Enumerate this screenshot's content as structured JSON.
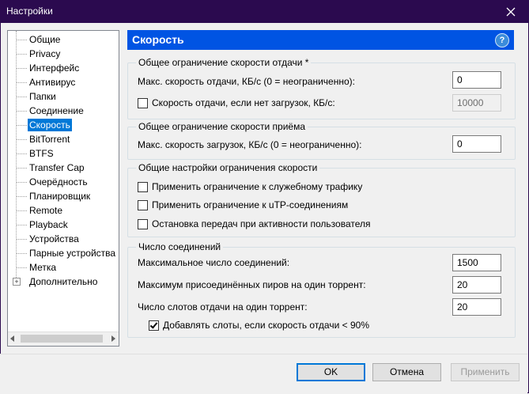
{
  "window": {
    "title": "Настройки"
  },
  "sidebar": {
    "items": [
      {
        "label": "Общие"
      },
      {
        "label": "Privacy"
      },
      {
        "label": "Интерфейс"
      },
      {
        "label": "Антивирус"
      },
      {
        "label": "Папки"
      },
      {
        "label": "Соединение"
      },
      {
        "label": "Скорость",
        "selected": true
      },
      {
        "label": "BitTorrent"
      },
      {
        "label": "BTFS"
      },
      {
        "label": "Transfer Cap"
      },
      {
        "label": "Очерёдность"
      },
      {
        "label": "Планировщик"
      },
      {
        "label": "Remote"
      },
      {
        "label": "Playback"
      },
      {
        "label": "Устройства"
      },
      {
        "label": "Парные устройства"
      },
      {
        "label": "Метка"
      },
      {
        "label": "Дополнительно",
        "expandable": true,
        "expander": "+"
      }
    ]
  },
  "panel": {
    "title": "Скорость",
    "help_label": "?",
    "upload_group": {
      "title": "Общее ограничение скорости отдачи *",
      "max_upload_label": "Макс. скорость отдачи, КБ/с (0 = неограниченно):",
      "max_upload_value": "0",
      "idle_upload_label": "Скорость отдачи, если нет загрузок, КБ/с:",
      "idle_upload_checked": false,
      "idle_upload_value": "10000"
    },
    "download_group": {
      "title": "Общее ограничение скорости приёма",
      "max_download_label": "Макс. скорость загрузок, КБ/с (0 = неограниченно):",
      "max_download_value": "0"
    },
    "general_group": {
      "title": "Общие настройки ограничения скорости",
      "options": [
        {
          "label": "Применить ограничение к служебному трафику",
          "checked": false
        },
        {
          "label": "Применить ограничение к uTP-соединениям",
          "checked": false
        },
        {
          "label": "Остановка передач при активности пользователя",
          "checked": false
        }
      ]
    },
    "connections_group": {
      "title": "Число соединений",
      "max_connections_label": "Максимальное число соединений:",
      "max_connections_value": "1500",
      "max_peers_label": "Максимум присоединённых пиров на один торрент:",
      "max_peers_value": "20",
      "upload_slots_label": "Число слотов отдачи на один торрент:",
      "upload_slots_value": "20",
      "extra_slots_label": "Добавлять слоты, если скорость отдачи < 90%",
      "extra_slots_checked": true
    }
  },
  "buttons": {
    "ok": "OK",
    "cancel": "Отмена",
    "apply": "Применить"
  },
  "colors": {
    "titlebar": "#2b0a4f",
    "header": "#0054e3",
    "selection": "#0078d7"
  }
}
